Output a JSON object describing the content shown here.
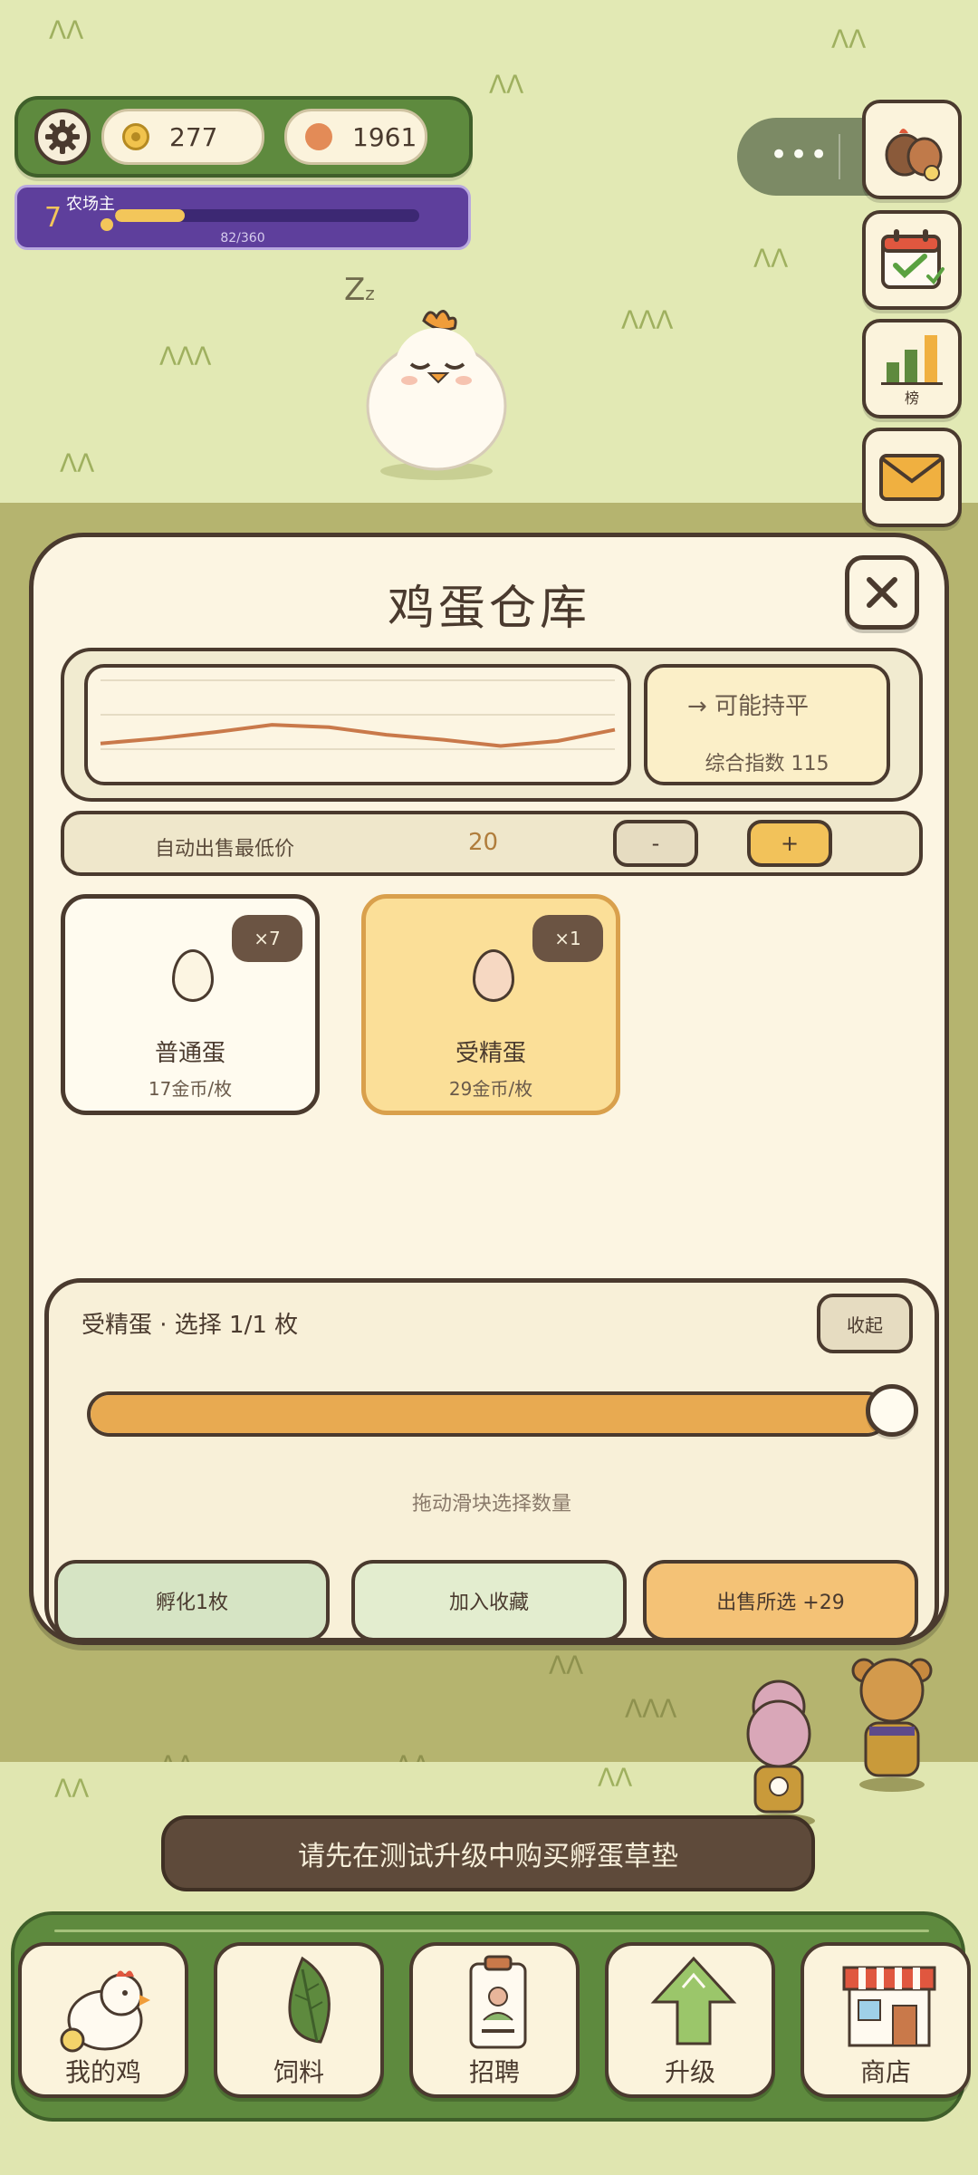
{
  "hud": {
    "coins": "277",
    "gems": "1961",
    "level": "7",
    "level_title": "农场主",
    "xp_text": "82/360",
    "xp_fraction": 0.228
  },
  "side_buttons": {
    "rank_label": "榜"
  },
  "warehouse": {
    "title": "鸡蛋仓库",
    "trend": "→ 可能持平",
    "index_text": "综合指数 115",
    "price_history": [
      38,
      42,
      47,
      53,
      51,
      45,
      41,
      36,
      40,
      49
    ],
    "auto_sell_label": "自动出售最低价",
    "auto_sell_value": "20",
    "minus_label": "-",
    "plus_label": "+",
    "eggs": [
      {
        "count": "×7",
        "name": "普通蛋",
        "price": "17金币/枚"
      },
      {
        "count": "×1",
        "name": "受精蛋",
        "price": "29金币/枚"
      }
    ]
  },
  "selection": {
    "title": "受精蛋 · 选择 1/1 枚",
    "collapse_label": "收起",
    "slider_fraction": 1.0,
    "hint": "拖动滑块选择数量",
    "hatch_label": "孵化1枚",
    "favorite_label": "加入收藏",
    "sell_label": "出售所选 +29"
  },
  "toast": "请先在测试升级中购买孵蛋草垫",
  "nav": [
    {
      "label": "我的鸡",
      "icon": "chicken-icon"
    },
    {
      "label": "饲料",
      "icon": "leaf-icon"
    },
    {
      "label": "招聘",
      "icon": "badge-icon"
    },
    {
      "label": "升级",
      "icon": "arrow-up-icon"
    },
    {
      "label": "商店",
      "icon": "shop-icon"
    }
  ],
  "colors": {
    "panel_bg": "#fcf5e2",
    "outline": "#4a3a2e",
    "accent_orange": "#e8aa51",
    "hud_green": "#5e8a3e",
    "level_purple": "#5e3f9c"
  }
}
